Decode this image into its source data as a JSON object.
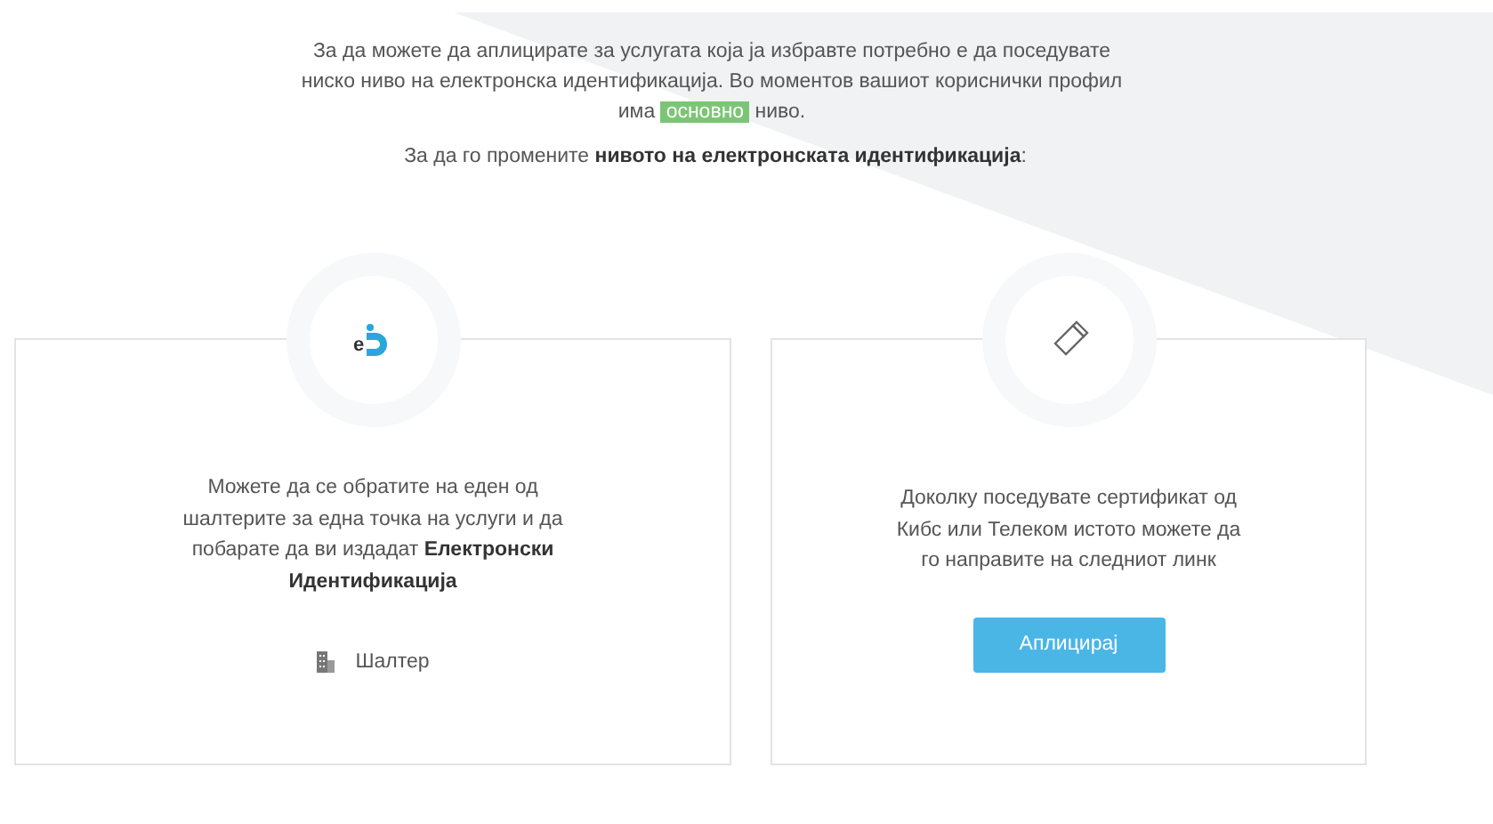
{
  "intro": {
    "before": "За да можете да аплицирате за услугата која ја избравте потребно е да поседувате ниско ниво на електронска идентификација. Во моментов вашиот кориснички профил има",
    "badge": "основно",
    "after": "ниво."
  },
  "instruction": "За да го промените **нивото на електронската идентификација**:",
  "cards": [
    {
      "kind": "counter",
      "icon_text": "e",
      "text": "Можете да се обратите на еден од шалтерите за една точка на услуги и да побарате да ви издадат **Електронски Идентификација**",
      "action": "Шалтер"
    },
    {
      "kind": "apply",
      "text": "Доколку поседувате сертификат од Кибс или Телеком истото можете да го направите на следниот линк",
      "action": "Аплицирај"
    }
  ]
}
